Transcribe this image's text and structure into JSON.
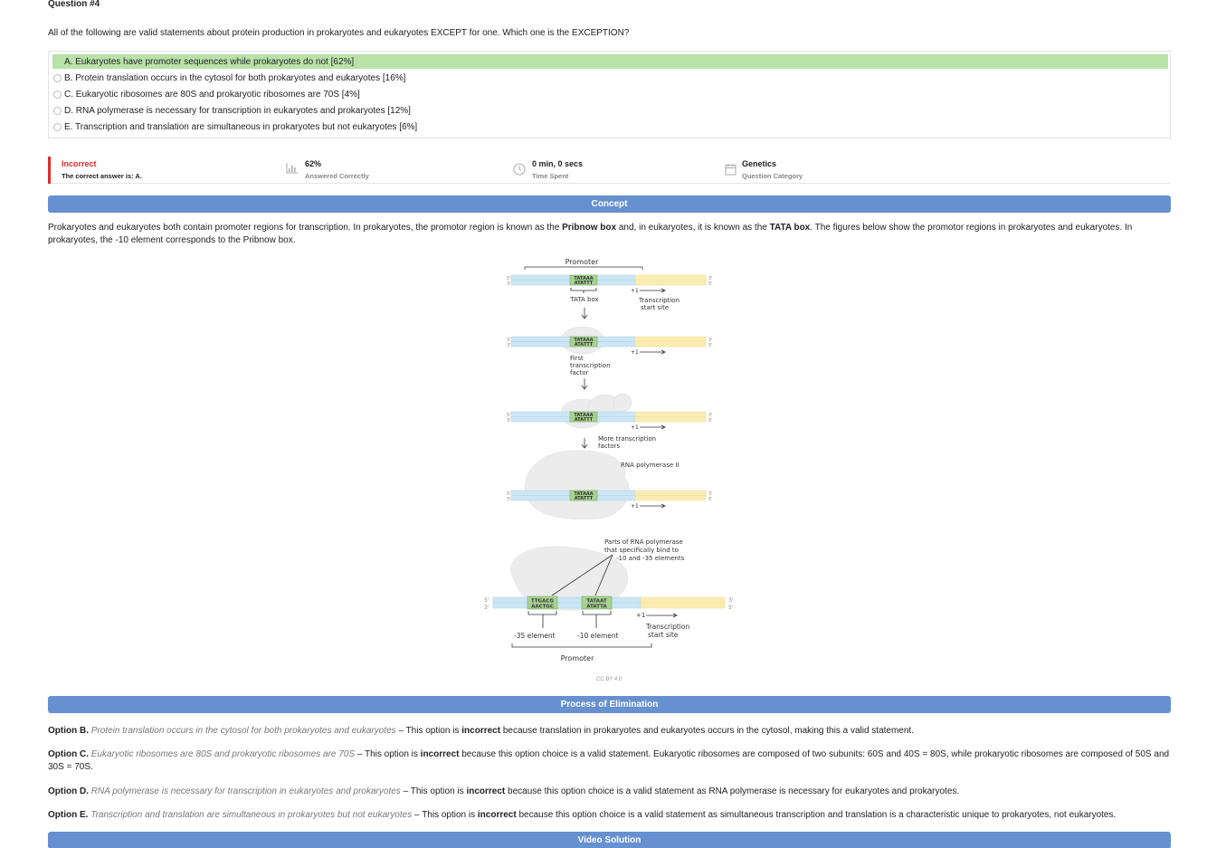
{
  "question": {
    "number_label": "Question #4",
    "stem": "All of the following are valid statements about protein production in prokaryotes and eukaryotes EXCEPT for one. Which one is the EXCEPTION?",
    "options": [
      {
        "label": "A. Eukaryotes have promoter sequences while prokaryotes do not [62%]",
        "correct": true
      },
      {
        "label": "B. Protein translation occurs in the cytosol for both prokaryotes and eukaryotes [16%]",
        "correct": false
      },
      {
        "label": "C. Eukaryotic ribosomes are 80S and prokaryotic ribosomes are 70S [4%]",
        "correct": false
      },
      {
        "label": "D. RNA polymerase is necessary for transcription in eukaryotes and prokaryotes [12%]",
        "correct": false
      },
      {
        "label": "E. Transcription and translation are simultaneous in prokaryotes but not eukaryotes [6%]",
        "correct": false
      }
    ]
  },
  "result": {
    "status": "Incorrect",
    "correct_answer_text": "The correct answer is: A.",
    "percent_correct": "62%",
    "percent_label": "Answered Correctly",
    "time_spent": "0 min, 0 secs",
    "time_label": "Time Spent",
    "category": "Genetics",
    "category_label": "Question Category",
    "icons": [
      "bar-chart-icon",
      "clock-icon",
      "calendar-icon"
    ],
    "status_color": "#e02b2b"
  },
  "concept": {
    "header": "Concept",
    "text_1": "Prokaryotes and eukaryotes both contain promoter regions for transcription. In prokaryotes, the promotor region is known as the ",
    "bold_1": "Pribnow box",
    "text_2": " and, in eukaryotes, it is known as the ",
    "bold_2": "TATA box",
    "text_3": ". The figures below show the promotor regions in prokaryotes and eukaryotes. In prokaryotes, the -10 element corresponds to the Pribnow box."
  },
  "figure": {
    "promoter_top": "Promoter",
    "tata_top": "TATAAA",
    "tata_bottom": "ATATTT",
    "five_prime": "5'",
    "three_prime": "3'",
    "tata_box": "TATA box",
    "plus_one": "+1",
    "transcription_start_1": "Transcription",
    "transcription_start_2": "start site",
    "first_tf_1": "First",
    "first_tf_2": "transcription",
    "first_tf_3": "factor",
    "more_tf_1": "More transcription",
    "more_tf_2": "factors",
    "rna_pol": "RNA polymerase II",
    "parts_1": "Parts of RNA polymerase",
    "parts_2": "that specifically bind to",
    "parts_3": "-10 and -35 elements",
    "m35_top": "TTGACG",
    "m35_bottom": "AACTGC",
    "m10_top": "TATAAT",
    "m10_bottom": "ATATTA",
    "m35_label": "-35 element",
    "m10_label": "-10 element",
    "promoter_bottom": "Promoter",
    "credit": "CC BY 4.0"
  },
  "elimination": {
    "header": "Process of Elimination",
    "items": [
      {
        "opt": "Option B.",
        "quote": "Protein translation occurs in the cytosol for both prokaryotes and eukaryotes",
        "pre": " – This option is ",
        "kw": "incorrect",
        "post": " because translation in prokaryotes and eukaryotes occurs in the cytosol, making this a valid statement."
      },
      {
        "opt": "Option C.",
        "quote": "Eukaryotic ribosomes are 80S and prokaryotic ribosomes are 70S",
        "pre": " – This option is ",
        "kw": "incorrect",
        "post": " because this option choice is a valid statement. Eukaryotic ribosomes are composed of two subunits: 60S and 40S = 80S, while prokaryotic ribosomes are composed of 50S and 30S = 70S."
      },
      {
        "opt": "Option D.",
        "quote": "RNA polymerase is necessary for transcription in eukaryotes and prokaryotes",
        "pre": " – This option is ",
        "kw": "incorrect",
        "post": " because this option choice is a valid statement as RNA polymerase is necessary for eukaryotes and prokaryotes."
      },
      {
        "opt": "Option E.",
        "quote": "Transcription and translation are simultaneous in prokaryotes but not eukaryotes",
        "pre": " – This option is ",
        "kw": "incorrect",
        "post": " because this option choice is a valid statement as simultaneous transcription and translation is a characteristic unique to prokaryotes, not eukaryotes."
      }
    ]
  },
  "video": {
    "header": "Video Solution"
  },
  "colors": {
    "correct_bg": "#b9e2a9",
    "bar": "#6690d0",
    "incorrect": "#e02b2b"
  }
}
